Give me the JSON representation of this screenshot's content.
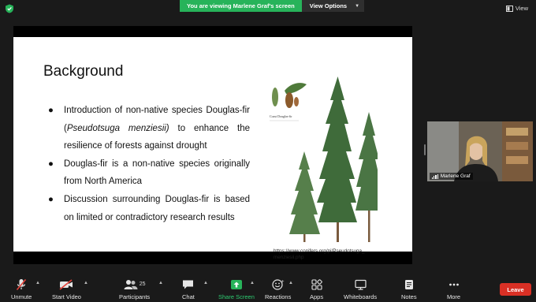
{
  "top_bar": {
    "share_banner": "You are viewing Marlene Graf's screen",
    "view_options": "View Options",
    "view_label": "View"
  },
  "slide": {
    "title": "Background",
    "bullets": [
      "Introduction of non-native species Douglas-fir (Pseudotsuga menziesii) to enhance the resilience of forests against drought",
      "Douglas-fir is a non-native species originally from North America",
      "Discussion surrounding Douglas-fir is based on limited or contradictory research results"
    ],
    "bullet1_parts": {
      "before": "Introduction of non-native species Douglas-fir (",
      "italic": "Pseudotsuga menziesii)",
      "after": " to enhance the resilience of forests against drought"
    },
    "figure_title": "Coast Douglas-fir",
    "caption": "https://www.conifers.org/pi/Pseudotsuga_ menziesii.php"
  },
  "participant": {
    "name": "Marlene Graf"
  },
  "toolbar": {
    "unmute": "Unmute",
    "start_video": "Start Video",
    "participants": "Participants",
    "participants_count": "25",
    "chat": "Chat",
    "share_screen": "Share Screen",
    "reactions": "Reactions",
    "apps": "Apps",
    "whiteboards": "Whiteboards",
    "notes": "Notes",
    "more": "More",
    "leave": "Leave"
  },
  "colors": {
    "share_green": "#27b35a",
    "leave_red": "#d93025",
    "muted_red": "#e5423a"
  }
}
